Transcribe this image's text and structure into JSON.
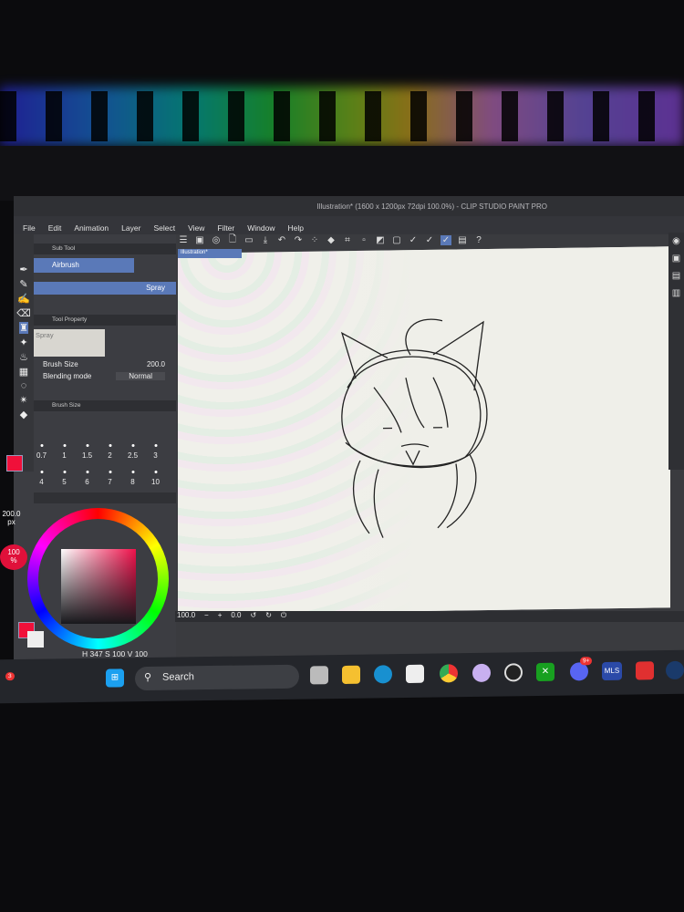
{
  "window": {
    "title": "Illustration* (1600 x 1200px 72dpi 100.0%) - CLIP STUDIO PAINT PRO"
  },
  "menu": [
    "File",
    "Edit",
    "Animation",
    "Layer",
    "Select",
    "View",
    "Filter",
    "Window",
    "Help"
  ],
  "subtool": {
    "header": "Sub Tool",
    "selected": "Airbrush",
    "variant": "Spray"
  },
  "tool_property": {
    "header": "Tool Property",
    "preset": "Spray",
    "brush_size_label": "Brush Size",
    "brush_size_value": "200.0",
    "blending_label": "Blending mode",
    "blending_value": "Normal"
  },
  "brush_size_panel": {
    "header": "Brush Size",
    "sizes": [
      "0.7",
      "1",
      "1.5",
      "2",
      "2.5",
      "3",
      "4",
      "5",
      "6",
      "7",
      "8",
      "10"
    ]
  },
  "left_badges": {
    "size": "200.0",
    "unit": "px",
    "opacity": "100",
    "percent": "%"
  },
  "color": {
    "h": "347",
    "s": "100",
    "v": "100",
    "main_color": "#f0103a",
    "sub_color": "#eeeeee"
  },
  "canvas": {
    "tab": "Illustration*",
    "zoom": "100.0",
    "angle": "0.0"
  },
  "taskbar": {
    "search": "Search",
    "notification_count": "3",
    "discord_badge": "9+",
    "mls": "MLS"
  }
}
